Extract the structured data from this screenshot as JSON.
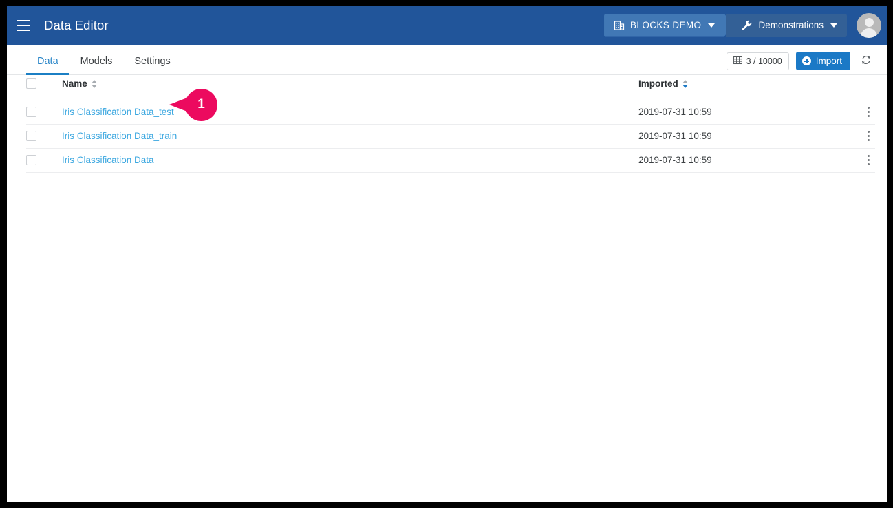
{
  "window": {
    "frame_color": "#000000"
  },
  "appbar": {
    "menu_icon": "hamburger-icon",
    "title": "Data Editor",
    "background": "#21559a",
    "breadcrumbs": [
      {
        "icon": "building-icon",
        "label": "BLOCKS DEMO",
        "caret": "chevron-down-icon",
        "background": "#4178b5"
      },
      {
        "icon": "wrench-icon",
        "label": "Demonstrations",
        "caret": "chevron-down-icon",
        "background": "#336096"
      }
    ],
    "avatar": "user-avatar-icon"
  },
  "tabs": [
    {
      "label": "Data",
      "active": true
    },
    {
      "label": "Models",
      "active": false
    },
    {
      "label": "Settings",
      "active": false
    }
  ],
  "toolbar": {
    "count_icon": "table-grid-icon",
    "count_label": "3 / 10000",
    "import_label": "Import",
    "import_icon": "plus-circle-icon",
    "import_color": "#1b79c6",
    "refresh_icon": "refresh-icon"
  },
  "table": {
    "columns": [
      {
        "key": "select",
        "label": ""
      },
      {
        "key": "name",
        "label": "Name",
        "sort": "none"
      },
      {
        "key": "imported",
        "label": "Imported",
        "sort": "desc"
      },
      {
        "key": "menu",
        "label": ""
      }
    ],
    "link_color": "#3ba7e0",
    "rows": [
      {
        "name": "Iris Classification Data_test",
        "imported": "2019-07-31 10:59",
        "checked": false,
        "menu": "kebab-menu-icon"
      },
      {
        "name": "Iris Classification Data_train",
        "imported": "2019-07-31 10:59",
        "checked": false,
        "menu": "kebab-menu-icon"
      },
      {
        "name": "Iris Classification Data",
        "imported": "2019-07-31 10:59",
        "checked": false,
        "menu": "kebab-menu-icon"
      }
    ]
  },
  "annotation": {
    "number": "1",
    "color": "#ec0a5f",
    "target_row": 0
  }
}
